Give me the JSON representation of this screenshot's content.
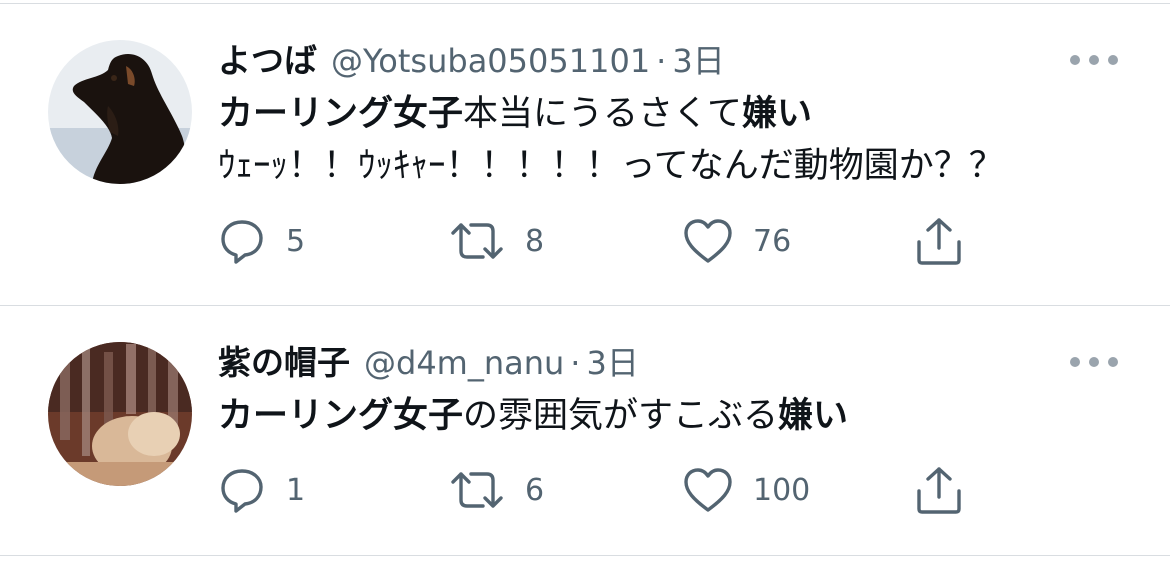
{
  "tweets": [
    {
      "name": "よつば",
      "handle": "@Yotsuba05051101",
      "separator": "·",
      "time": "3日",
      "text_lines": [
        [
          {
            "text": "カーリング女子",
            "bold": true
          },
          {
            "text": "本当にうるさくて",
            "bold": false
          },
          {
            "text": "嫌い",
            "bold": true
          }
        ],
        [
          {
            "text": "ｳｪｰｯ！！ｳｯｷｬｰ！！！！！ってなんだ動物園か？？",
            "bold": false
          }
        ]
      ],
      "replies": "5",
      "retweets": "8",
      "likes": "76",
      "avatar_icon": "dog-avatar"
    },
    {
      "name": "紫の帽子",
      "handle": "@d4m_nanu",
      "separator": "·",
      "time": "3日",
      "text_lines": [
        [
          {
            "text": "カーリング女子",
            "bold": true
          },
          {
            "text": "の雰囲気がすこぶる",
            "bold": false
          },
          {
            "text": "嫌い",
            "bold": true
          }
        ]
      ],
      "replies": "1",
      "retweets": "6",
      "likes": "100",
      "avatar_icon": "blurry-photo-avatar"
    }
  ],
  "icons": {
    "reply": "speech-bubble-icon",
    "retweet": "retweet-icon",
    "like": "heart-icon",
    "share": "share-upload-icon",
    "more": "more-dots-icon"
  },
  "colors": {
    "text": "#0f1419",
    "secondary": "#536471",
    "icon": "#536471",
    "divider": "#d9dde1"
  }
}
